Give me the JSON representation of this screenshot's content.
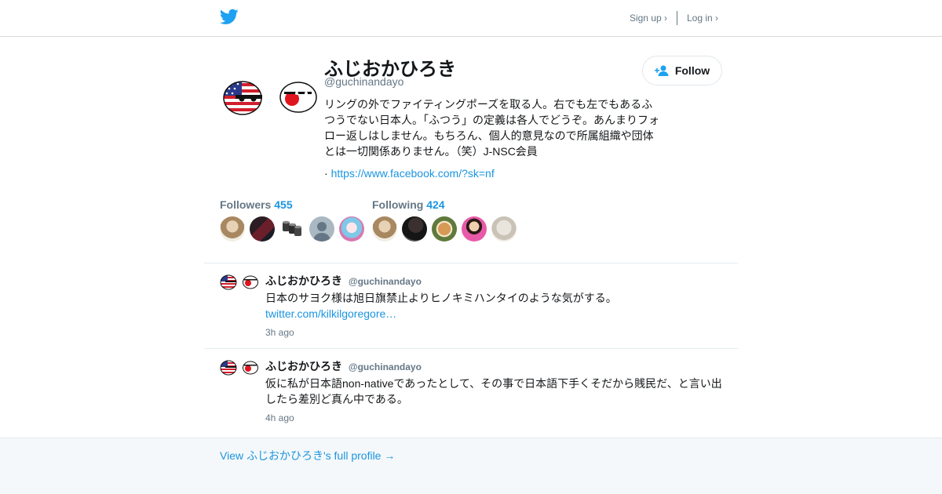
{
  "header": {
    "logo_icon": "twitter-bird-icon",
    "signup_label": "Sign up ›",
    "login_label": "Log in ›"
  },
  "profile": {
    "name": "ふじおかひろき",
    "handle": "@guchinandayo",
    "bio": "リングの外でファイティングポーズを取る人。右でも左でもあるふつうでない日本人。「ふつう」の定義は各人でどうぞ。あんまりフォロー返しはしません。もちろん、個人的意見なので所属組織や団体とは一切関係ありません。（笑）J-NSC会員",
    "link_prefix": "·",
    "link": "https://www.facebook.com/?sk=nf",
    "follow_label": "Follow"
  },
  "stats": {
    "followers_label": "Followers",
    "followers_count": "455",
    "following_label": "Following",
    "following_count": "424"
  },
  "tweets": [
    {
      "name": "ふじおかひろき",
      "handle": "@guchinandayo",
      "text": "日本のサヨク様は旭日旗禁止よりヒノキミハンタイのような気がする。",
      "link": "twitter.com/kilkilgoregore…",
      "time": "3h ago"
    },
    {
      "name": "ふじおかひろき",
      "handle": "@guchinandayo",
      "text": "仮に私が日本語non-nativeであったとして、その事で日本語下手くそだから賎民だ、と言い出したら差別ど真ん中である。",
      "time": "4h ago"
    }
  ],
  "footer": {
    "full_profile_link": "View ふじおかひろき's full profile →"
  },
  "colors": {
    "accent": "#1b95e0",
    "twitter_blue": "#1da1f2",
    "muted": "#657786"
  }
}
